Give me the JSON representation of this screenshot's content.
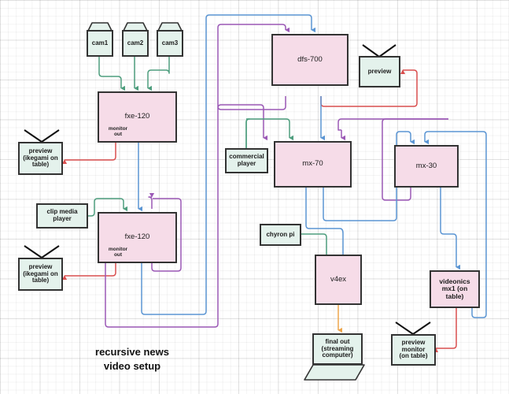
{
  "diagram": {
    "title_line1": "recursive news",
    "title_line2": "video setup",
    "colors": {
      "mixer_fill": "#f6dce8",
      "source_fill": "#e4f2ec",
      "node_stroke": "#333333",
      "wire_green": "#4e9e7e",
      "wire_blue": "#5b95d3",
      "wire_purple": "#9b59b6",
      "wire_red": "#d94f4f",
      "wire_orange": "#f0a martin"
    },
    "nodes": [
      {
        "id": "cam1",
        "label": "cam1",
        "kind": "camera"
      },
      {
        "id": "cam2",
        "label": "cam2",
        "kind": "camera"
      },
      {
        "id": "cam3",
        "label": "cam3",
        "kind": "camera"
      },
      {
        "id": "fxe120_top",
        "label": "fxe-120",
        "kind": "mixer",
        "sublabel": "monitor\nout"
      },
      {
        "id": "fxe120_bottom",
        "label": "fxe-120",
        "kind": "mixer",
        "sublabel": "monitor\nout"
      },
      {
        "id": "preview_ikegami_1",
        "label": "preview\n(ikegami on\ntable)",
        "kind": "monitor"
      },
      {
        "id": "preview_ikegami_2",
        "label": "preview\n(ikegami on\ntable)",
        "kind": "monitor"
      },
      {
        "id": "clip_media_player",
        "label": "clip media\nplayer",
        "kind": "source"
      },
      {
        "id": "dfs700",
        "label": "dfs-700",
        "kind": "mixer"
      },
      {
        "id": "preview_dfs",
        "label": "preview",
        "kind": "monitor"
      },
      {
        "id": "commercial_player",
        "label": "commercial\nplayer",
        "kind": "source"
      },
      {
        "id": "mx70",
        "label": "mx-70",
        "kind": "mixer"
      },
      {
        "id": "mx30",
        "label": "mx-30",
        "kind": "mixer"
      },
      {
        "id": "chyron_pi",
        "label": "chyron pi",
        "kind": "source"
      },
      {
        "id": "v4ex",
        "label": "v4ex",
        "kind": "mixer"
      },
      {
        "id": "videonics_mx1",
        "label": "videonics\nmx1 (on\ntable)",
        "kind": "mixer"
      },
      {
        "id": "final_out",
        "label": "final out\n(streaming\ncomputer)",
        "kind": "laptop"
      },
      {
        "id": "preview_monitor_table",
        "label": "preview\nmonitor\n(on table)",
        "kind": "monitor"
      }
    ],
    "labels": {
      "cam1": "cam1",
      "cam2": "cam2",
      "cam3": "cam3",
      "fxe120_top": "fxe-120",
      "fxe120_top_sub1": "monitor",
      "fxe120_top_sub2": "out",
      "fxe120_bottom": "fxe-120",
      "fxe120_bottom_sub1": "monitor",
      "fxe120_bottom_sub2": "out",
      "preview_ikegami_1_l1": "preview",
      "preview_ikegami_1_l2": "(ikegami on",
      "preview_ikegami_1_l3": "table)",
      "preview_ikegami_2_l1": "preview",
      "preview_ikegami_2_l2": "(ikegami on",
      "preview_ikegami_2_l3": "table)",
      "clip_media_player_l1": "clip media",
      "clip_media_player_l2": "player",
      "dfs700": "dfs-700",
      "preview_dfs": "preview",
      "commercial_player_l1": "commercial",
      "commercial_player_l2": "player",
      "mx70": "mx-70",
      "mx30": "mx-30",
      "chyron_pi": "chyron pi",
      "v4ex": "v4ex",
      "videonics_mx1_l1": "videonics",
      "videonics_mx1_l2": "mx1 (on",
      "videonics_mx1_l3": "table)",
      "final_out_l1": "final out",
      "final_out_l2": "(streaming",
      "final_out_l3": "computer)",
      "preview_monitor_table_l1": "preview",
      "preview_monitor_table_l2": "monitor",
      "preview_monitor_table_l3": "(on table)"
    }
  }
}
